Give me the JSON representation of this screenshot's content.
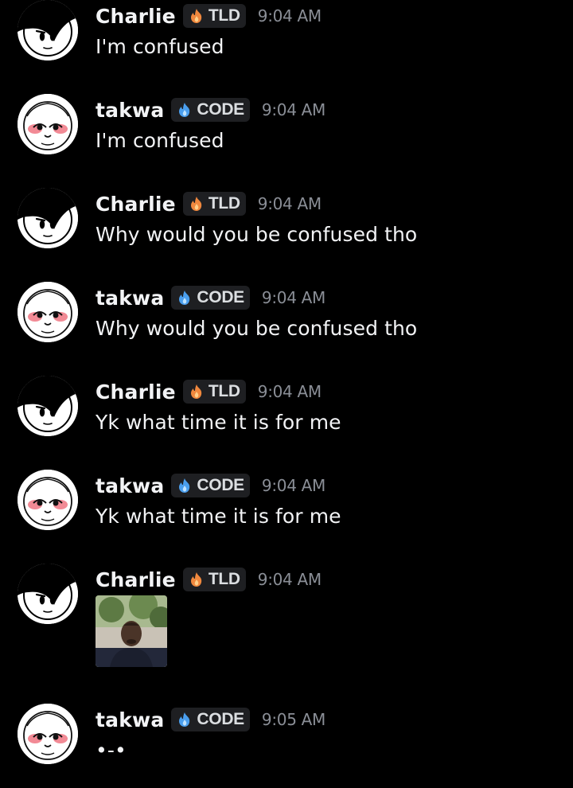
{
  "colors": {
    "background": "#000000",
    "username": "#f2f3f5",
    "timestamp": "#8a8e96",
    "tag_background": "#1e1f22",
    "tld_icon": "#f0883e",
    "code_icon": "#4a9eed"
  },
  "messages": [
    {
      "author": "Charlie",
      "tag": "TLD",
      "tag_icon": "flame-icon",
      "time": "9:04 AM",
      "text": "I'm confused"
    },
    {
      "author": "takwa",
      "tag": "CODE",
      "tag_icon": "blue-flame-icon",
      "time": "9:04 AM",
      "text": "I'm confused"
    },
    {
      "author": "Charlie",
      "tag": "TLD",
      "tag_icon": "flame-icon",
      "time": "9:04 AM",
      "text": "Why would you be confused tho"
    },
    {
      "author": "takwa",
      "tag": "CODE",
      "tag_icon": "blue-flame-icon",
      "time": "9:04 AM",
      "text": "Why would you be confused tho"
    },
    {
      "author": "Charlie",
      "tag": "TLD",
      "tag_icon": "flame-icon",
      "time": "9:04 AM",
      "text": "Yk what time it is for me"
    },
    {
      "author": "takwa",
      "tag": "CODE",
      "tag_icon": "blue-flame-icon",
      "time": "9:04 AM",
      "text": "Yk what time it is for me"
    },
    {
      "author": "Charlie",
      "tag": "TLD",
      "tag_icon": "flame-icon",
      "time": "9:04 AM",
      "attachment": "image-attachment"
    },
    {
      "author": "takwa",
      "tag": "CODE",
      "tag_icon": "blue-flame-icon",
      "time": "9:05 AM",
      "text": "•-•"
    }
  ]
}
